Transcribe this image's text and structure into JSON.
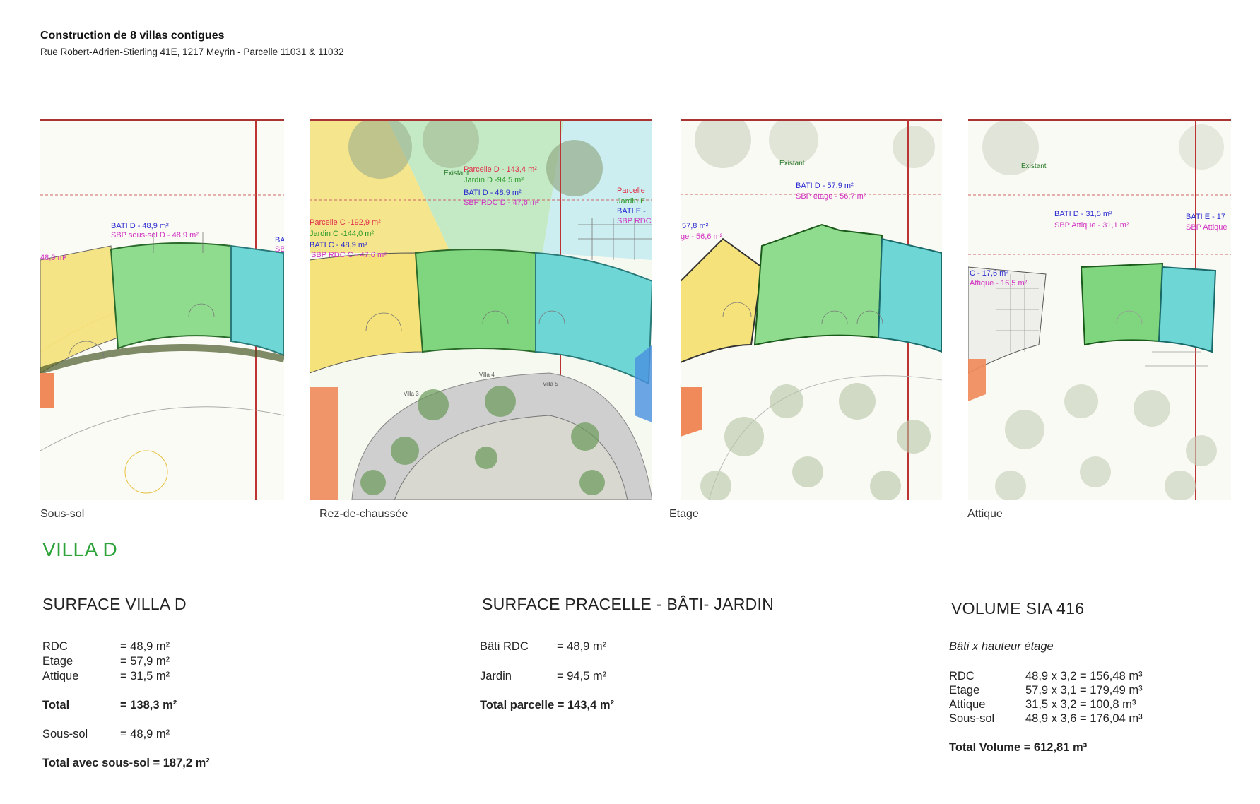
{
  "header": {
    "title": "Construction de 8 villas contigues",
    "subtitle": "Rue Robert-Adrien-Stierling 41E, 1217 Meyrin - Parcelle 11031 & 11032"
  },
  "plans": {
    "sous_sol": {
      "caption": "Sous-sol",
      "labels": {
        "bati": "BATI D - 48,9 m²",
        "sbp": "SBP sous-sol D - 48,9 m²",
        "left_area": "48,9 m²",
        "bati_e": "BA",
        "sbp_e": "SB"
      }
    },
    "rdc": {
      "caption": "Rez-de-chaussée",
      "labels": {
        "parcelle_d": "Parcelle D - 143,4 m²",
        "jardin_d": "Jardin D -94,5 m²",
        "bati_d": "BATI D - 48,9 m²",
        "sbp_d": "SBP RDC D - 47,6 m²",
        "parcelle_c": "Parcelle C -192,9 m²",
        "jardin_c": "Jardin C -144,0 m²",
        "bati_c": "BATI C - 48,9 m²",
        "sbp_c": "SBP RDC C - 47,6 m²",
        "parcelle_e": "Parcelle",
        "jardin_e": "Jardin E",
        "bati_e": "BATI E -",
        "sbp_e": "SBP RDC",
        "existant": "Existant",
        "villa3": "Villa 3",
        "villa4": "Villa 4",
        "villa5": "Villa 5"
      }
    },
    "etage": {
      "caption": "Etage",
      "labels": {
        "bati": "BATI D - 57,9 m²",
        "sbp": "SBP étage - 56,7 m²",
        "left_area": "57,8 m²",
        "left_sbp": "ge - 56,6 m²",
        "existant": "Existant"
      }
    },
    "attique": {
      "caption": "Attique",
      "labels": {
        "bati": "BATI D - 31,5 m²",
        "sbp": "SBP Attique - 31,1 m²",
        "bati_e": "BATI E - 17",
        "sbp_e": "SBP Attique",
        "left_area": "C - 17,6 m²",
        "left_sbp": "Attique - 16,5 m²",
        "existant": "Existant"
      }
    }
  },
  "villa_title": "VILLA D",
  "surface_villa": {
    "title": "SURFACE VILLA D",
    "rows": [
      {
        "label": "RDC",
        "value": "= 48,9 m²"
      },
      {
        "label": "Etage",
        "value": "= 57,9 m²"
      },
      {
        "label": "Attique",
        "value": "= 31,5 m²"
      }
    ],
    "total_label": "Total",
    "total_value": "= 138,3 m²",
    "sous_sol_label": "Sous-sol",
    "sous_sol_value": "= 48,9 m²",
    "total_ss": "Total avec sous-sol  = 187,2 m²"
  },
  "surface_parcelle": {
    "title": "SURFACE PRACELLE - BÂTI- JARDIN",
    "rows": [
      {
        "label": "Bâti RDC",
        "value": "= 48,9 m²"
      },
      {
        "label": "Jardin",
        "value": "= 94,5  m²"
      }
    ],
    "total": "Total parcelle = 143,4  m²"
  },
  "volume": {
    "title": "VOLUME SIA 416",
    "subtitle": "Bâti x hauteur étage",
    "rows": [
      {
        "label": "RDC",
        "value": "48,9 x 3,2 = 156,48 m³"
      },
      {
        "label": "Etage",
        "value": "57,9 x 3,1 = 179,49 m³"
      },
      {
        "label": "Attique",
        "value": "31,5 x 3,2 = 100,8 m³"
      },
      {
        "label": "Sous-sol",
        "value": "48,9 x 3,6 = 176,04 m³"
      }
    ],
    "total": "Total Volume = 612,81 m³"
  },
  "colors": {
    "accent_green": "#2ea33a",
    "villa_yellow": "#f5e27a",
    "villa_green": "#7fd67f",
    "villa_cyan": "#6fd6d6",
    "villa_orange": "#f08a5a",
    "label_red": "#e0304a",
    "label_blue": "#2a2ad0",
    "label_magenta": "#d030c0",
    "label_green": "#2a9a2a"
  }
}
